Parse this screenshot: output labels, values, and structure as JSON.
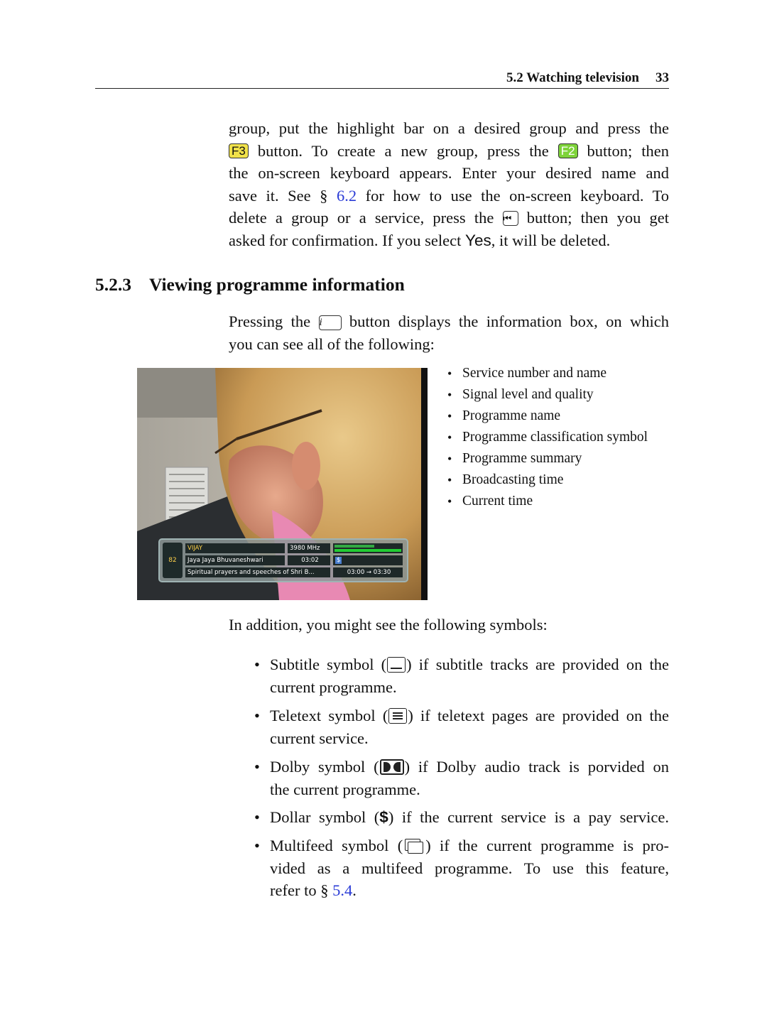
{
  "header": {
    "section_title": "5.2 Watching television",
    "page_number": "33"
  },
  "intro": {
    "l1": "group, put the highlight bar on a desired group and press the",
    "l2_key_f3": "F3",
    "l2_a": "button. To create a new group, press the",
    "l2_key_f2": "F2",
    "l2_b": "button; then",
    "l3": "the on-screen keyboard appears. Enter your desired name and",
    "l4_a": "save it. See §",
    "l4_ref": "6.2",
    "l4_b": "for how to use the on-screen keyboard. To",
    "l5_a": "delete a group or a service, press the",
    "l5_key_icon": "⏮",
    "l5_b": "button; then you get",
    "l6_a": "asked for confirmation. If you select",
    "l6_yes": "Yes",
    "l6_b": ", it will be deleted."
  },
  "section": {
    "number": "5.2.3",
    "title": "Viewing programme information"
  },
  "info_para": {
    "l1_a": "Pressing the",
    "l1_key": "i",
    "l1_b": "button displays the information box, on which",
    "l2": "you can see all of the following:"
  },
  "info_items": [
    "Service number and name",
    "Signal level and quality",
    "Programme name",
    "Programme classification symbol",
    "Programme summary",
    "Broadcasting time",
    "Current time"
  ],
  "tv_osd": {
    "service_number": "82",
    "service_name": "VIJAY",
    "frequency": "3980 MHz",
    "programme_name": "Jaya Jaya Bhuvaneshwari",
    "current_time": "03:02",
    "pay_symbol": "$",
    "summary": "Spiritual prayers and speeches of Shri B...",
    "broadcast_time": "03:00 → 03:30",
    "signal_level": 0.6,
    "signal_quality": 1.0
  },
  "addition": "In addition, you might see the following symbols:",
  "symbols": [
    {
      "icon": "subtitle-icon",
      "name": "Subtitle symbol (",
      "rest": ") if subtitle tracks are provided on the",
      "rest2": "current programme."
    },
    {
      "icon": "teletext-icon",
      "name": "Teletext symbol (",
      "rest": ") if teletext pages are provided on the",
      "rest2": "current service."
    },
    {
      "icon": "dolby-icon",
      "name": "Dolby symbol (",
      "rest": ") if Dolby audio track is porvided on",
      "rest2": "the current programme."
    },
    {
      "icon": "dollar-icon",
      "name": "Dollar symbol (",
      "glyph": "$",
      "rest": ") if the current service is a pay service."
    },
    {
      "icon": "multifeed-icon",
      "name": "Multifeed symbol (",
      "rest": ") if the current programme is pro-",
      "rest2": "vided as a multifeed programme. To use this feature,",
      "rest3_a": "refer to §",
      "rest3_ref": "5.4",
      "rest3_b": "."
    }
  ]
}
